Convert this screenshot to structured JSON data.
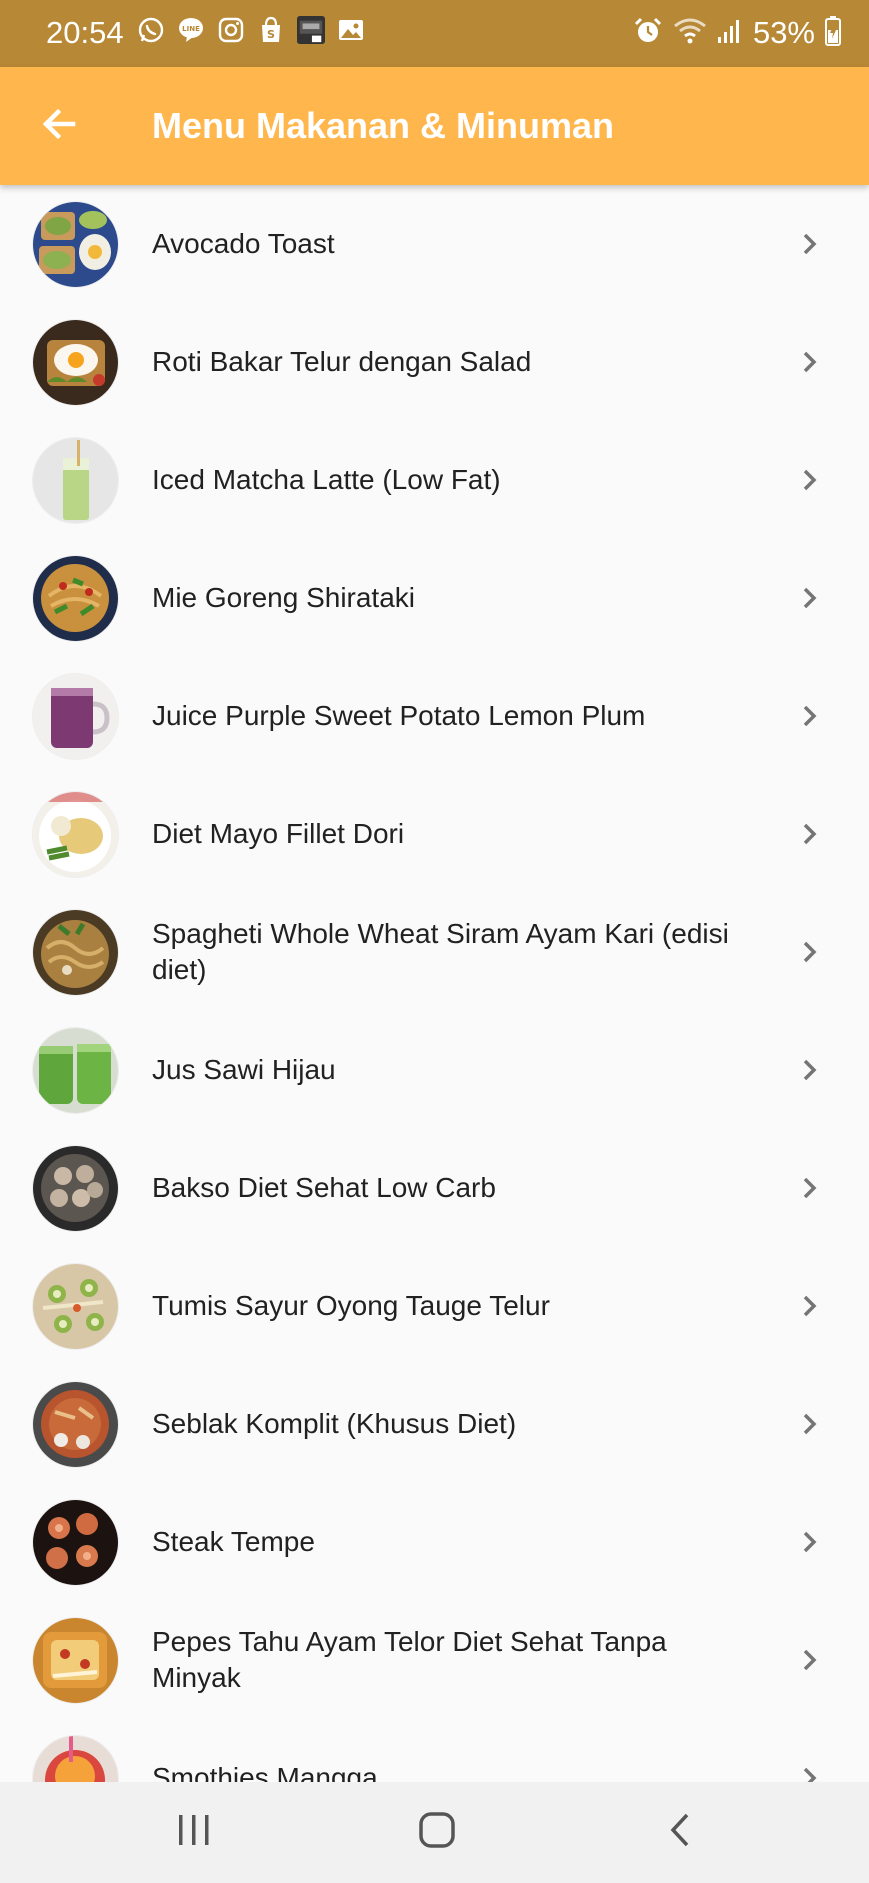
{
  "status_bar": {
    "time": "20:54",
    "battery_percent": "53%",
    "left_icons": [
      "whatsapp-icon",
      "line-icon",
      "instagram-icon",
      "shopee-icon",
      "game-icon",
      "gallery-icon"
    ],
    "right_icons": [
      "alarm-icon",
      "wifi-icon",
      "signal-icon",
      "battery-icon"
    ]
  },
  "app_bar": {
    "title": "Menu Makanan & Minuman",
    "back_icon": "arrow-back-icon",
    "color": "#ffb74d"
  },
  "menu_items": [
    {
      "label": "Avocado Toast"
    },
    {
      "label": "Roti Bakar Telur dengan Salad"
    },
    {
      "label": "Iced Matcha Latte (Low Fat)"
    },
    {
      "label": "Mie Goreng Shirataki"
    },
    {
      "label": "Juice Purple Sweet Potato Lemon Plum"
    },
    {
      "label": "Diet Mayo Fillet Dori"
    },
    {
      "label": "Spagheti Whole Wheat Siram Ayam Kari (edisi diet)"
    },
    {
      "label": "Jus Sawi Hijau"
    },
    {
      "label": "Bakso Diet Sehat Low Carb"
    },
    {
      "label": "Tumis Sayur Oyong Tauge Telur"
    },
    {
      "label": "Seblak Komplit (Khusus Diet)"
    },
    {
      "label": "Steak Tempe"
    },
    {
      "label": "Pepes Tahu Ayam Telor Diet Sehat Tanpa Minyak"
    },
    {
      "label": "Smothies Mangga"
    }
  ],
  "nav_bar": {
    "recents_icon": "recents-icon",
    "home_icon": "home-icon",
    "back_icon": "back-icon"
  }
}
